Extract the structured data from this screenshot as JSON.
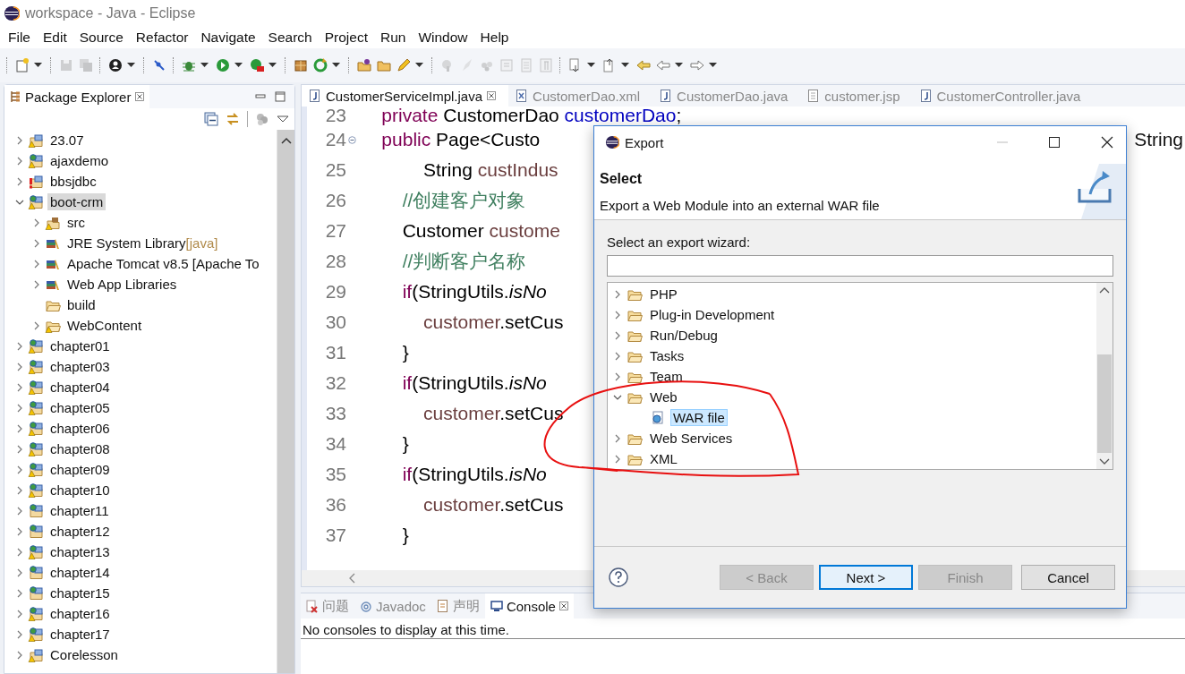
{
  "window": {
    "title": "workspace - Java - Eclipse"
  },
  "menu": [
    "File",
    "Edit",
    "Source",
    "Refactor",
    "Navigate",
    "Search",
    "Project",
    "Run",
    "Window",
    "Help"
  ],
  "toolbar": [
    [
      {
        "kind": "new",
        "dropdown": true,
        "disabled": false
      }
    ],
    [
      {
        "kind": "save",
        "dropdown": false,
        "disabled": true
      },
      {
        "kind": "save-all",
        "dropdown": false,
        "disabled": true
      }
    ],
    [
      {
        "kind": "profile",
        "dropdown": true,
        "disabled": false
      }
    ],
    [
      {
        "kind": "pin",
        "dropdown": false,
        "disabled": false
      }
    ],
    [
      {
        "kind": "debug",
        "dropdown": true,
        "disabled": false
      },
      {
        "kind": "run",
        "dropdown": true,
        "disabled": false
      },
      {
        "kind": "external",
        "dropdown": true,
        "disabled": false
      }
    ],
    [
      {
        "kind": "package",
        "dropdown": false,
        "disabled": false
      },
      {
        "kind": "refresh",
        "dropdown": true,
        "disabled": false
      }
    ],
    [
      {
        "kind": "open-project",
        "dropdown": false,
        "disabled": false
      },
      {
        "kind": "folder",
        "dropdown": false,
        "disabled": false
      },
      {
        "kind": "pencil",
        "dropdown": true,
        "disabled": false
      }
    ],
    [
      {
        "kind": "tag",
        "dropdown": false,
        "disabled": true
      },
      {
        "kind": "pen",
        "dropdown": false,
        "disabled": true
      },
      {
        "kind": "dots",
        "dropdown": false,
        "disabled": true
      },
      {
        "kind": "document",
        "dropdown": false,
        "disabled": true
      },
      {
        "kind": "page",
        "dropdown": false,
        "disabled": true
      },
      {
        "kind": "paragraph",
        "dropdown": false,
        "disabled": true
      }
    ],
    [
      {
        "kind": "next",
        "dropdown": true,
        "disabled": false
      },
      {
        "kind": "previous",
        "dropdown": true,
        "disabled": false
      },
      {
        "kind": "last-edit",
        "dropdown": false,
        "disabled": false
      },
      {
        "kind": "back",
        "dropdown": true,
        "disabled": false
      },
      {
        "kind": "forward",
        "dropdown": true,
        "disabled": false
      }
    ]
  ],
  "explorer": {
    "title": "Package Explorer",
    "items": [
      {
        "label": "23.07",
        "kind": "java-project",
        "warning": true,
        "error": false,
        "expanded": false,
        "selected": false
      },
      {
        "label": "ajaxdemo",
        "kind": "web-project",
        "warning": true,
        "error": false,
        "expanded": false,
        "selected": false
      },
      {
        "label": "bbsjdbc",
        "kind": "java-project",
        "warning": false,
        "error": true,
        "expanded": false,
        "selected": false
      },
      {
        "label": "boot-crm",
        "kind": "web-project",
        "warning": true,
        "error": false,
        "expanded": true,
        "selected": true,
        "children": [
          {
            "label": "src",
            "kind": "source-folder",
            "warning": true,
            "error": false,
            "expanded": false,
            "selected": false
          },
          {
            "label": "JRE System Library",
            "decoration": "[java]",
            "kind": "library",
            "warning": false,
            "error": false,
            "expanded": false,
            "selected": false
          },
          {
            "label": "Apache Tomcat v8.5 [Apache To",
            "kind": "library",
            "warning": false,
            "error": false,
            "expanded": false,
            "selected": false
          },
          {
            "label": "Web App Libraries",
            "kind": "library",
            "warning": false,
            "error": false,
            "expanded": false,
            "selected": false
          },
          {
            "label": "build",
            "kind": "folder",
            "warning": false,
            "error": false,
            "selected": false
          },
          {
            "label": "WebContent",
            "kind": "folder",
            "warning": true,
            "error": false,
            "expanded": false,
            "selected": false
          }
        ]
      },
      {
        "label": "chapter01",
        "kind": "web-project",
        "warning": true,
        "error": false,
        "expanded": false,
        "selected": false
      },
      {
        "label": "chapter03",
        "kind": "web-project",
        "warning": true,
        "error": false,
        "expanded": false,
        "selected": false
      },
      {
        "label": "chapter04",
        "kind": "web-project",
        "warning": true,
        "error": false,
        "expanded": false,
        "selected": false
      },
      {
        "label": "chapter05",
        "kind": "web-project",
        "warning": true,
        "error": false,
        "expanded": false,
        "selected": false
      },
      {
        "label": "chapter06",
        "kind": "web-project",
        "warning": true,
        "error": false,
        "expanded": false,
        "selected": false
      },
      {
        "label": "chapter08",
        "kind": "web-project",
        "warning": true,
        "error": false,
        "expanded": false,
        "selected": false
      },
      {
        "label": "chapter09",
        "kind": "web-project",
        "warning": true,
        "error": false,
        "expanded": false,
        "selected": false
      },
      {
        "label": "chapter10",
        "kind": "web-project",
        "warning": true,
        "error": false,
        "expanded": false,
        "selected": false
      },
      {
        "label": "chapter11",
        "kind": "web-project",
        "warning": false,
        "error": false,
        "expanded": false,
        "selected": false
      },
      {
        "label": "chapter12",
        "kind": "web-project",
        "warning": false,
        "error": false,
        "expanded": false,
        "selected": false
      },
      {
        "label": "chapter13",
        "kind": "web-project",
        "warning": true,
        "error": false,
        "expanded": false,
        "selected": false
      },
      {
        "label": "chapter14",
        "kind": "web-project",
        "warning": false,
        "error": false,
        "expanded": false,
        "selected": false
      },
      {
        "label": "chapter15",
        "kind": "web-project",
        "warning": false,
        "error": false,
        "expanded": false,
        "selected": false
      },
      {
        "label": "chapter16",
        "kind": "web-project",
        "warning": true,
        "error": false,
        "expanded": false,
        "selected": false
      },
      {
        "label": "chapter17",
        "kind": "web-project",
        "warning": true,
        "error": false,
        "expanded": false,
        "selected": false
      },
      {
        "label": "Corelesson",
        "kind": "java-project",
        "warning": true,
        "error": false,
        "expanded": false,
        "selected": false
      }
    ]
  },
  "editor": {
    "tabs": [
      {
        "label": "CustomerServiceImpl.java",
        "kind": "java",
        "selected": true
      },
      {
        "label": "CustomerDao.xml",
        "kind": "xml",
        "selected": false
      },
      {
        "label": "CustomerDao.java",
        "kind": "java",
        "selected": false
      },
      {
        "label": "customer.jsp",
        "kind": "jsp",
        "selected": false
      },
      {
        "label": "CustomerController.java",
        "kind": "java",
        "selected": false
      }
    ],
    "lines": [
      {
        "number": "23",
        "segments": [
          {
            "kind": "keyword",
            "text": "    private"
          },
          {
            "kind": "plain",
            "text": " CustomerDao "
          },
          {
            "kind": "field",
            "text": "customerDao"
          },
          {
            "kind": "plain",
            "text": ";"
          }
        ]
      },
      {
        "number": "24",
        "folding": true,
        "segments": [
          {
            "kind": "keyword",
            "text": "    public"
          },
          {
            "kind": "plain",
            "text": " Page<Custo"
          }
        ],
        "right_text": "String"
      },
      {
        "number": "25",
        "segments": [
          {
            "kind": "plain",
            "text": "            String "
          },
          {
            "kind": "var",
            "text": "custIndus"
          }
        ]
      },
      {
        "number": "26",
        "segments": [
          {
            "kind": "comment",
            "text": "        //创建客户对象"
          }
        ]
      },
      {
        "number": "27",
        "segments": [
          {
            "kind": "plain",
            "text": "        Customer "
          },
          {
            "kind": "var",
            "text": "custome"
          }
        ]
      },
      {
        "number": "28",
        "segments": [
          {
            "kind": "comment",
            "text": "        //判断客户名称"
          }
        ]
      },
      {
        "number": "29",
        "segments": [
          {
            "kind": "keyword",
            "text": "        if"
          },
          {
            "kind": "plain",
            "text": "(StringUtils."
          },
          {
            "kind": "static",
            "text": "isNo"
          }
        ]
      },
      {
        "number": "30",
        "segments": [
          {
            "kind": "var",
            "text": "            customer"
          },
          {
            "kind": "plain",
            "text": ".setCus"
          }
        ]
      },
      {
        "number": "31",
        "segments": [
          {
            "kind": "plain",
            "text": "        }"
          }
        ]
      },
      {
        "number": "32",
        "segments": [
          {
            "kind": "keyword",
            "text": "        if"
          },
          {
            "kind": "plain",
            "text": "(StringUtils."
          },
          {
            "kind": "static",
            "text": "isNo"
          }
        ]
      },
      {
        "number": "33",
        "segments": [
          {
            "kind": "var",
            "text": "            customer"
          },
          {
            "kind": "plain",
            "text": ".setCus"
          }
        ]
      },
      {
        "number": "34",
        "segments": [
          {
            "kind": "plain",
            "text": "        }"
          }
        ]
      },
      {
        "number": "35",
        "segments": [
          {
            "kind": "keyword",
            "text": "        if"
          },
          {
            "kind": "plain",
            "text": "(StringUtils."
          },
          {
            "kind": "static",
            "text": "isNo"
          }
        ]
      },
      {
        "number": "36",
        "segments": [
          {
            "kind": "var",
            "text": "            customer"
          },
          {
            "kind": "plain",
            "text": ".setCus"
          }
        ]
      },
      {
        "number": "37",
        "segments": [
          {
            "kind": "plain",
            "text": "        }"
          }
        ]
      }
    ]
  },
  "bottom_panel": {
    "tabs": [
      {
        "label": "问题",
        "kind": "problems",
        "selected": false
      },
      {
        "label": "Javadoc",
        "kind": "javadoc",
        "selected": false
      },
      {
        "label": "声明",
        "kind": "declaration",
        "selected": false
      },
      {
        "label": "Console",
        "kind": "console",
        "selected": true
      }
    ],
    "message": "No consoles to display at this time."
  },
  "dialog": {
    "title": "Export",
    "heading": "Select",
    "description": "Export a Web Module into an external WAR file",
    "filter_label": "Select an export wizard:",
    "wizards": [
      {
        "label": "PHP",
        "kind": "folder",
        "expanded": false,
        "selected": false
      },
      {
        "label": "Plug-in Development",
        "kind": "folder",
        "expanded": false,
        "selected": false
      },
      {
        "label": "Run/Debug",
        "kind": "folder",
        "expanded": false,
        "selected": false
      },
      {
        "label": "Tasks",
        "kind": "folder",
        "expanded": false,
        "selected": false
      },
      {
        "label": "Team",
        "kind": "folder",
        "expanded": false,
        "selected": false
      },
      {
        "label": "Web",
        "kind": "folder",
        "expanded": true,
        "selected": false,
        "children": [
          {
            "label": "WAR file",
            "kind": "war",
            "selected": true
          }
        ]
      },
      {
        "label": "Web Services",
        "kind": "folder",
        "expanded": false,
        "selected": false
      },
      {
        "label": "XML",
        "kind": "folder",
        "expanded": false,
        "selected": false
      }
    ],
    "buttons": [
      {
        "label": "< Back",
        "disabled": true,
        "default": false
      },
      {
        "label": "Next >",
        "disabled": false,
        "default": true
      },
      {
        "label": "Finish",
        "disabled": true,
        "default": false
      },
      {
        "label": "Cancel",
        "disabled": false,
        "default": false
      }
    ]
  }
}
